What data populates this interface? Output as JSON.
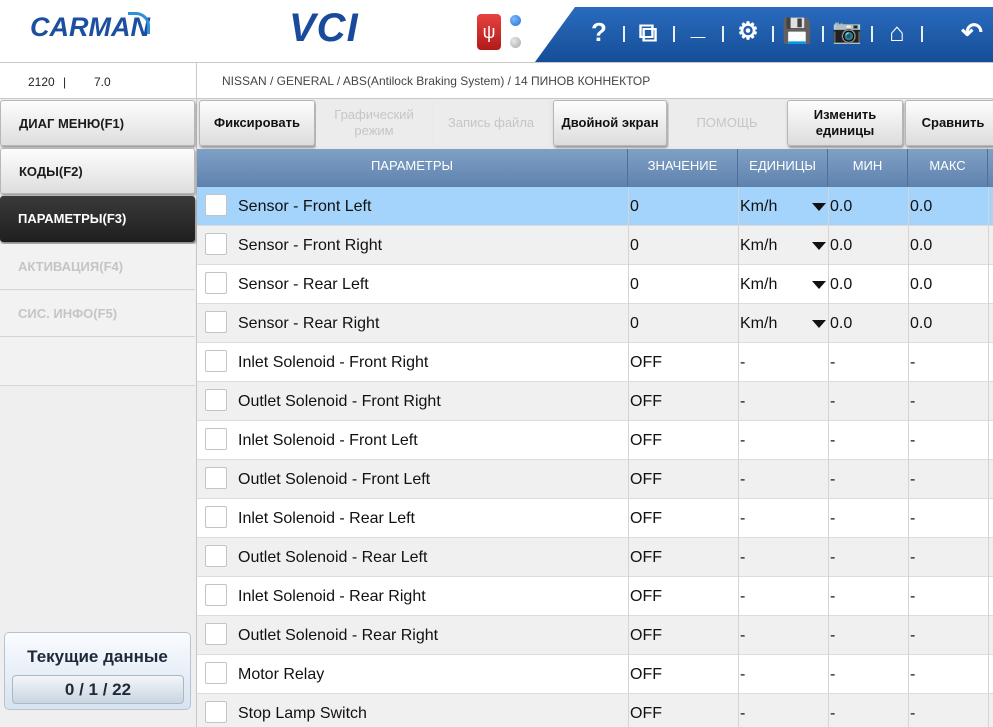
{
  "header": {
    "logo": "CARMAN",
    "product": "VCI",
    "usb_icon": "usb-icon",
    "toolbar": [
      {
        "icon": "help-icon",
        "glyph": "?"
      },
      {
        "icon": "window-switch-icon",
        "glyph": "⧉"
      },
      {
        "icon": "minimize-icon",
        "glyph": "_"
      },
      {
        "icon": "settings-icon",
        "glyph": "⚙"
      },
      {
        "icon": "save-icon",
        "glyph": "💾"
      },
      {
        "icon": "camera-icon",
        "glyph": "📷"
      },
      {
        "icon": "home-icon",
        "glyph": "⌂"
      },
      {
        "icon": "back-icon",
        "glyph": "↶"
      }
    ],
    "colors": {
      "brand": "#1c4fa0",
      "toolbar": "#1f5fae"
    }
  },
  "info": {
    "code": "2120",
    "separator": "|",
    "version": "7.0",
    "path": "NISSAN / GENERAL / ABS(Antilock Braking System) / 14 ПИНОВ КОННЕКТОР"
  },
  "sidebar": {
    "items": [
      {
        "label": "ДИАГ МЕНЮ(F1)",
        "state": "raised"
      },
      {
        "label": "КОДЫ(F2)",
        "state": "raised"
      },
      {
        "label": "ПАРАМЕТРЫ(F3)",
        "state": "active"
      },
      {
        "label": "АКТИВАЦИЯ(F4)",
        "state": "disabled"
      },
      {
        "label": "СИС. ИНФО(F5)",
        "state": "disabled"
      }
    ],
    "current": {
      "title": "Текущие данные",
      "count": "0 / 1 / 22"
    }
  },
  "functions": [
    {
      "label": "Фиксировать",
      "enabled": true
    },
    {
      "label": "Графический режим",
      "enabled": false
    },
    {
      "label": "Запись файла",
      "enabled": false
    },
    {
      "label": "Двойной экран",
      "enabled": true
    },
    {
      "label": "ПОМОЩЬ",
      "enabled": false
    },
    {
      "label": "Изменить единицы",
      "enabled": true
    },
    {
      "label": "Сравнить",
      "enabled": true
    }
  ],
  "table": {
    "columns": [
      "ПАРАМЕТРЫ",
      "ЗНАЧЕНИЕ",
      "ЕДИНИЦЫ",
      "МИН",
      "МАКС"
    ],
    "rows": [
      {
        "name": "Sensor - Front Left",
        "value": "0",
        "unit": "Km/h",
        "dropdown": true,
        "min": "0.0",
        "max": "0.0",
        "selected": true
      },
      {
        "name": "Sensor - Front Right",
        "value": "0",
        "unit": "Km/h",
        "dropdown": true,
        "min": "0.0",
        "max": "0.0"
      },
      {
        "name": "Sensor - Rear Left",
        "value": "0",
        "unit": "Km/h",
        "dropdown": true,
        "min": "0.0",
        "max": "0.0"
      },
      {
        "name": "Sensor - Rear Right",
        "value": "0",
        "unit": "Km/h",
        "dropdown": true,
        "min": "0.0",
        "max": "0.0"
      },
      {
        "name": "Inlet Solenoid - Front Right",
        "value": "OFF",
        "unit": "-",
        "min": "-",
        "max": "-"
      },
      {
        "name": "Outlet Solenoid - Front Right",
        "value": "OFF",
        "unit": "-",
        "min": "-",
        "max": "-"
      },
      {
        "name": "Inlet Solenoid - Front Left",
        "value": "OFF",
        "unit": "-",
        "min": "-",
        "max": "-"
      },
      {
        "name": "Outlet Solenoid - Front Left",
        "value": "OFF",
        "unit": "-",
        "min": "-",
        "max": "-"
      },
      {
        "name": "Inlet Solenoid - Rear Left",
        "value": "OFF",
        "unit": "-",
        "min": "-",
        "max": "-"
      },
      {
        "name": "Outlet Solenoid - Rear Left",
        "value": "OFF",
        "unit": "-",
        "min": "-",
        "max": "-"
      },
      {
        "name": "Inlet Solenoid - Rear Right",
        "value": "OFF",
        "unit": "-",
        "min": "-",
        "max": "-"
      },
      {
        "name": "Outlet Solenoid - Rear Right",
        "value": "OFF",
        "unit": "-",
        "min": "-",
        "max": "-"
      },
      {
        "name": "Motor Relay",
        "value": "OFF",
        "unit": "-",
        "min": "-",
        "max": "-"
      },
      {
        "name": "Stop Lamp Switch",
        "value": "OFF",
        "unit": "-",
        "min": "-",
        "max": "-"
      }
    ]
  }
}
